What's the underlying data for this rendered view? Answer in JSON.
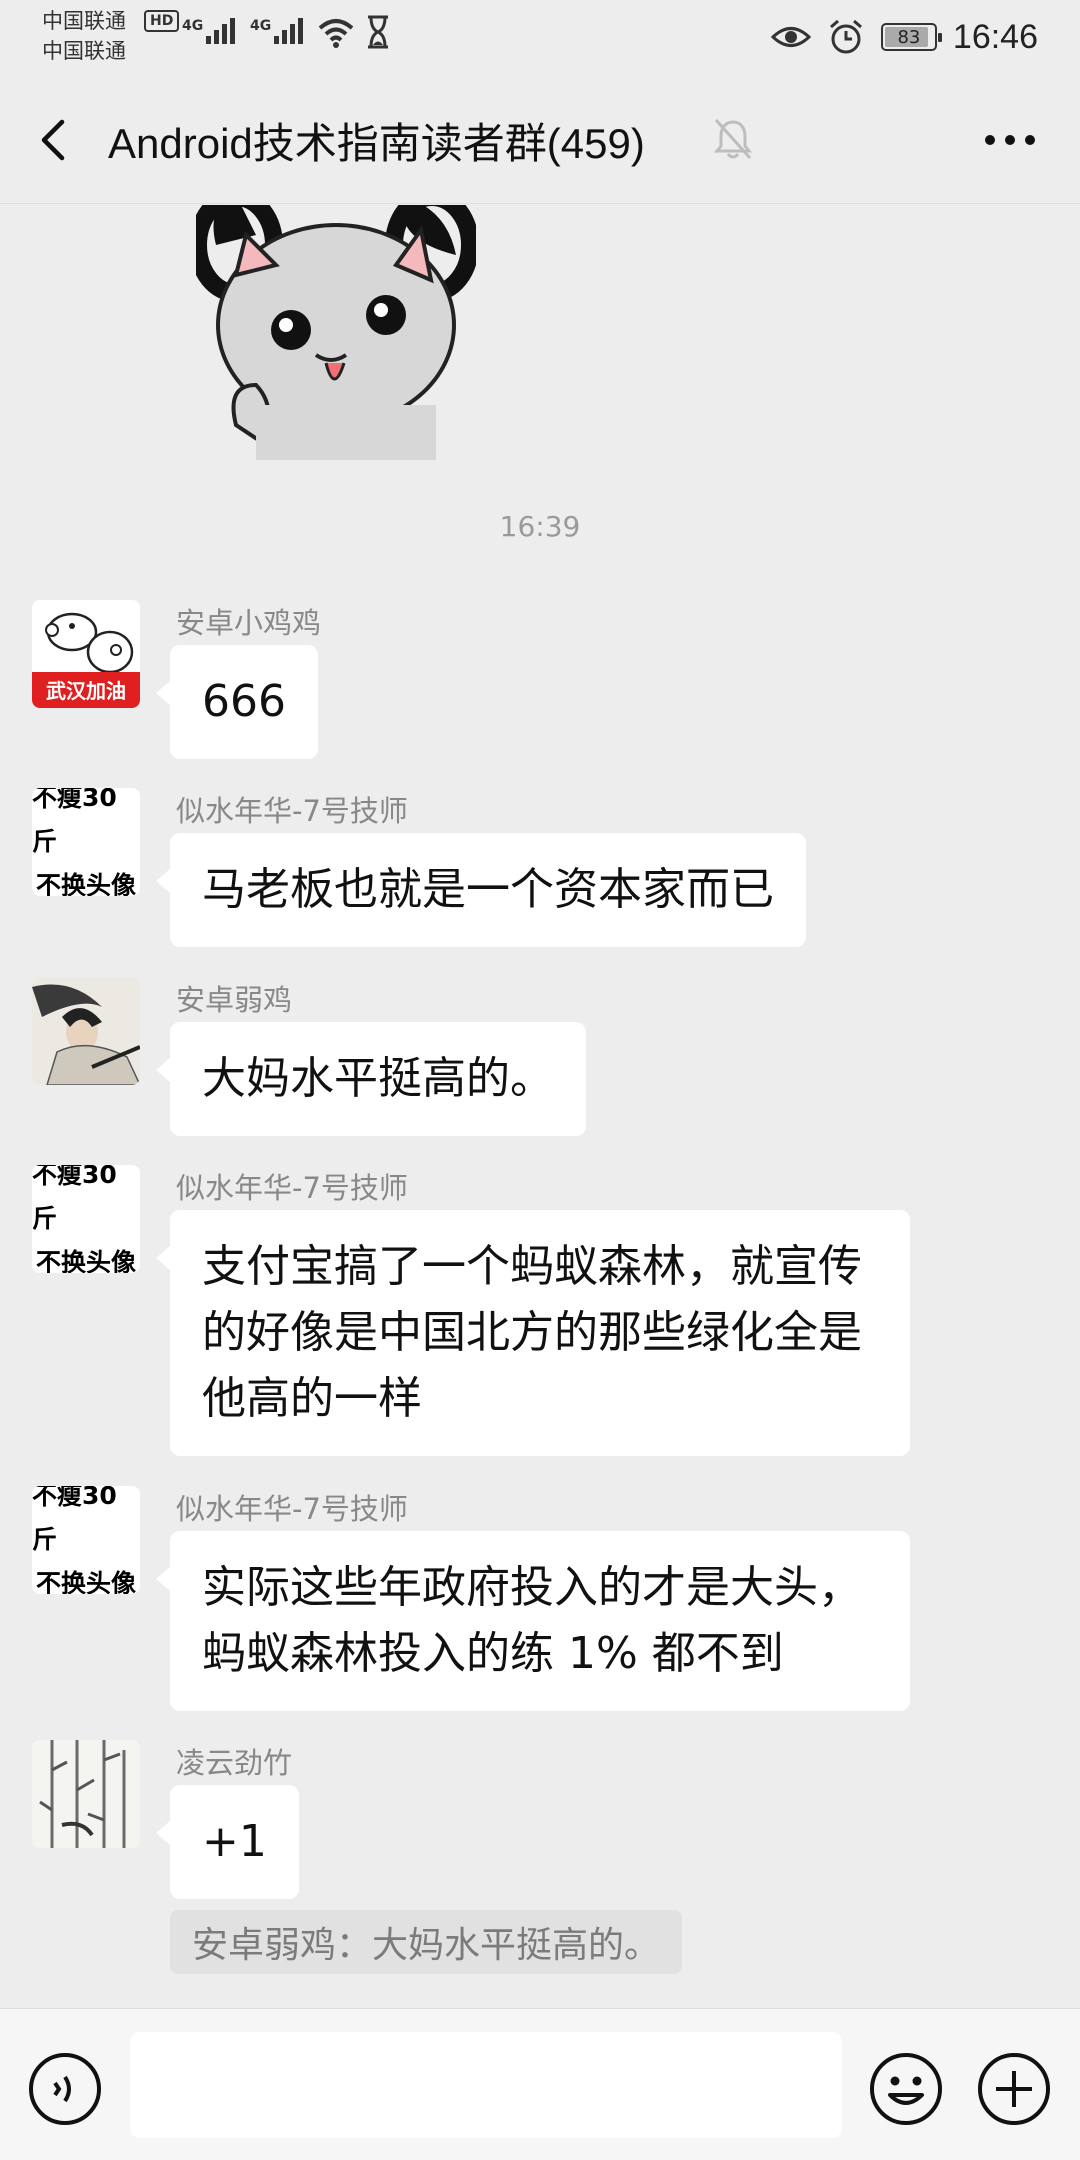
{
  "status_bar": {
    "carrier_top": "中国联通",
    "carrier_bottom": "中国联通",
    "hd_badge": "HD",
    "network_1": "4G",
    "network_2": "4G",
    "battery": "83",
    "battery_level": 0.83,
    "time": "16:46"
  },
  "header": {
    "title": "Android技术指南读者群(459)"
  },
  "chat": {
    "timestamp": "16:39",
    "messages": [
      {
        "sender": "安卓小鸡鸡",
        "text": "666",
        "avatar_caption": "武汉加油"
      },
      {
        "sender": "似水年华-7号技师",
        "text": "马老板也就是一个资本家而已",
        "avatar_lines": [
          "不瘦30斤",
          "不换头像"
        ]
      },
      {
        "sender": "安卓弱鸡",
        "text": "大妈水平挺高的。"
      },
      {
        "sender": "似水年华-7号技师",
        "text": "支付宝搞了一个蚂蚁森林，就宣传的好像是中国北方的那些绿化全是他高的一样",
        "avatar_lines": [
          "不瘦30斤",
          "不换头像"
        ]
      },
      {
        "sender": "似水年华-7号技师",
        "text": "实际这些年政府投入的才是大头，蚂蚁森林投入的练 1% 都不到",
        "avatar_lines": [
          "不瘦30斤",
          "不换头像"
        ]
      },
      {
        "sender": "凌云劲竹",
        "text": "+1"
      }
    ],
    "quote": "安卓弱鸡：大妈水平挺高的。"
  },
  "input": {
    "placeholder": ""
  },
  "colors": {
    "background": "#ededed",
    "bubble": "#ffffff",
    "nickname": "#888888",
    "quote_bg": "#e1e1e1"
  }
}
